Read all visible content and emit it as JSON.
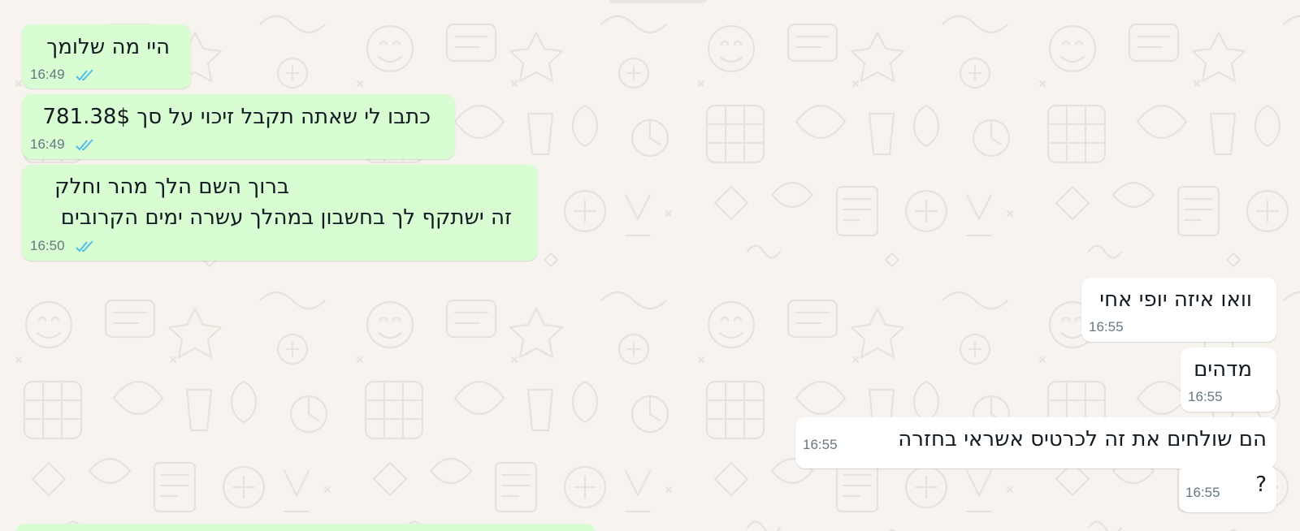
{
  "chat": {
    "messages": [
      {
        "direction": "out",
        "text": "היי מה שלומך",
        "time": "16:49",
        "status": "read"
      },
      {
        "direction": "out",
        "text": "כתבו לי שאתה תקבל זיכוי על סך 781.38$",
        "time": "16:49",
        "status": "read"
      },
      {
        "direction": "out",
        "lines": [
          "ברוך השם הלך מהר וחלק",
          "זה ישתקף לך בחשבון במהלך עשרה ימים הקרובים"
        ],
        "time": "16:50",
        "status": "read"
      },
      {
        "direction": "in",
        "text": "וואו איזה יופי אחי",
        "time": "16:55"
      },
      {
        "direction": "in",
        "text": "מדהים",
        "time": "16:55"
      },
      {
        "direction": "in",
        "text": "הם שולחים את זה לכרטיס אשראי בחזרה",
        "time": "16:55"
      },
      {
        "direction": "in",
        "text": "?",
        "time": "16:55"
      }
    ]
  },
  "colors": {
    "background": "#f7f3ef",
    "outgoing_bubble": "#d9fdd3",
    "incoming_bubble": "#ffffff",
    "read_ticks": "#53bdeb",
    "timestamp": "#667781",
    "text": "#111b21"
  },
  "icons": {
    "read_receipt": "double-check-icon"
  }
}
